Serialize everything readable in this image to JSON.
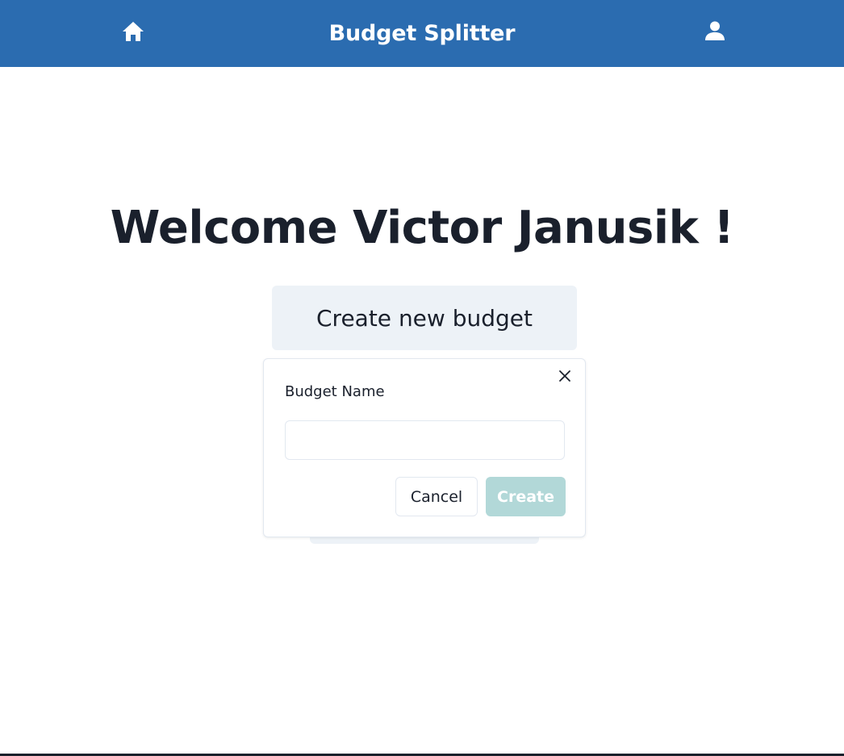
{
  "header": {
    "title": "Budget Splitter",
    "home_icon": "home-icon",
    "user_icon": "user-icon",
    "background_color": "#2b6cb0"
  },
  "main": {
    "welcome_text": "Welcome Victor Janusik !",
    "create_new_label": "Create new budget"
  },
  "popover": {
    "close_icon": "close-icon",
    "field_label": "Budget Name",
    "name_value": "",
    "cancel_label": "Cancel",
    "create_label": "Create",
    "create_color": "#b2d8d8"
  }
}
